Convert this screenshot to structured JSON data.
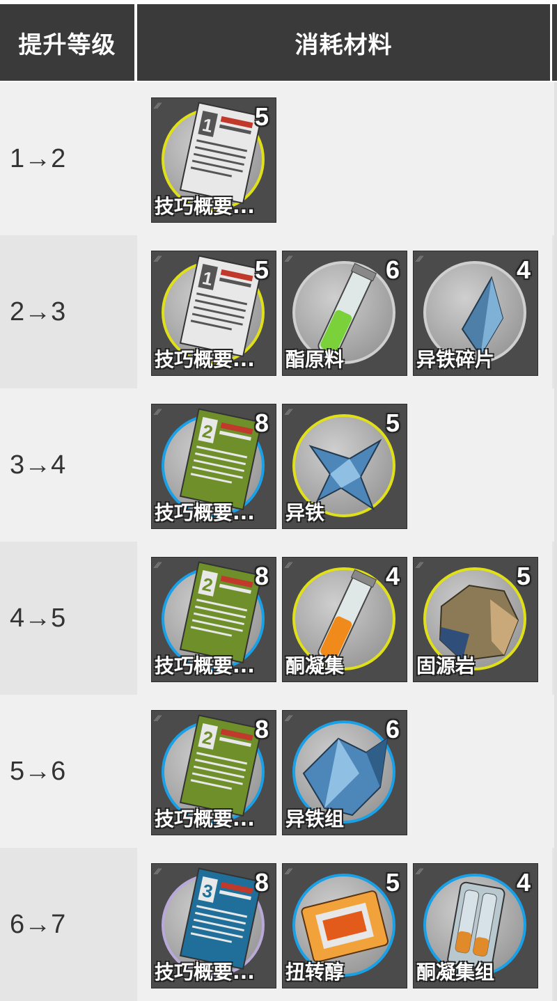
{
  "header": {
    "level_label": "提升等级",
    "materials_label": "消耗材料"
  },
  "colors": {
    "ring_yellow": "#e0e01a",
    "ring_blue": "#1aa0e6",
    "ring_gray": "#cfcfcf",
    "ring_purple": "#b9a9d9",
    "row_odd": "#f0f0f0",
    "row_even": "#e5e5e5",
    "header_bg": "#3a3a3a"
  },
  "rows": [
    {
      "level": "1→2",
      "materials": [
        {
          "name": "技巧概要...",
          "count": "5",
          "icon": "manual-white-icon",
          "ring": "yellow"
        }
      ]
    },
    {
      "level": "2→3",
      "materials": [
        {
          "name": "技巧概要...",
          "count": "5",
          "icon": "manual-white-icon",
          "ring": "yellow"
        },
        {
          "name": "酯原料",
          "count": "6",
          "icon": "green-vial-icon",
          "ring": "gray"
        },
        {
          "name": "异铁碎片",
          "count": "4",
          "icon": "iron-shard-icon",
          "ring": "gray"
        }
      ]
    },
    {
      "level": "3→4",
      "materials": [
        {
          "name": "技巧概要...",
          "count": "8",
          "icon": "manual-green-icon",
          "ring": "blue"
        },
        {
          "name": "异铁",
          "count": "5",
          "icon": "iron-crystal-icon",
          "ring": "yellow"
        }
      ]
    },
    {
      "level": "4→5",
      "materials": [
        {
          "name": "技巧概要...",
          "count": "8",
          "icon": "manual-green-icon",
          "ring": "blue"
        },
        {
          "name": "酮凝集",
          "count": "4",
          "icon": "orange-vial-icon",
          "ring": "yellow"
        },
        {
          "name": "固源岩",
          "count": "5",
          "icon": "rock-icon",
          "ring": "yellow"
        }
      ]
    },
    {
      "level": "5→6",
      "materials": [
        {
          "name": "技巧概要...",
          "count": "8",
          "icon": "manual-green-icon",
          "ring": "blue"
        },
        {
          "name": "异铁组",
          "count": "6",
          "icon": "iron-cluster-icon",
          "ring": "blue"
        }
      ]
    },
    {
      "level": "6→7",
      "materials": [
        {
          "name": "技巧概要...",
          "count": "8",
          "icon": "manual-blue-icon",
          "ring": "purple"
        },
        {
          "name": "扭转醇",
          "count": "5",
          "icon": "orange-packet-icon",
          "ring": "blue"
        },
        {
          "name": "酮凝集组",
          "count": "4",
          "icon": "vial-pack-icon",
          "ring": "blue"
        }
      ]
    }
  ]
}
